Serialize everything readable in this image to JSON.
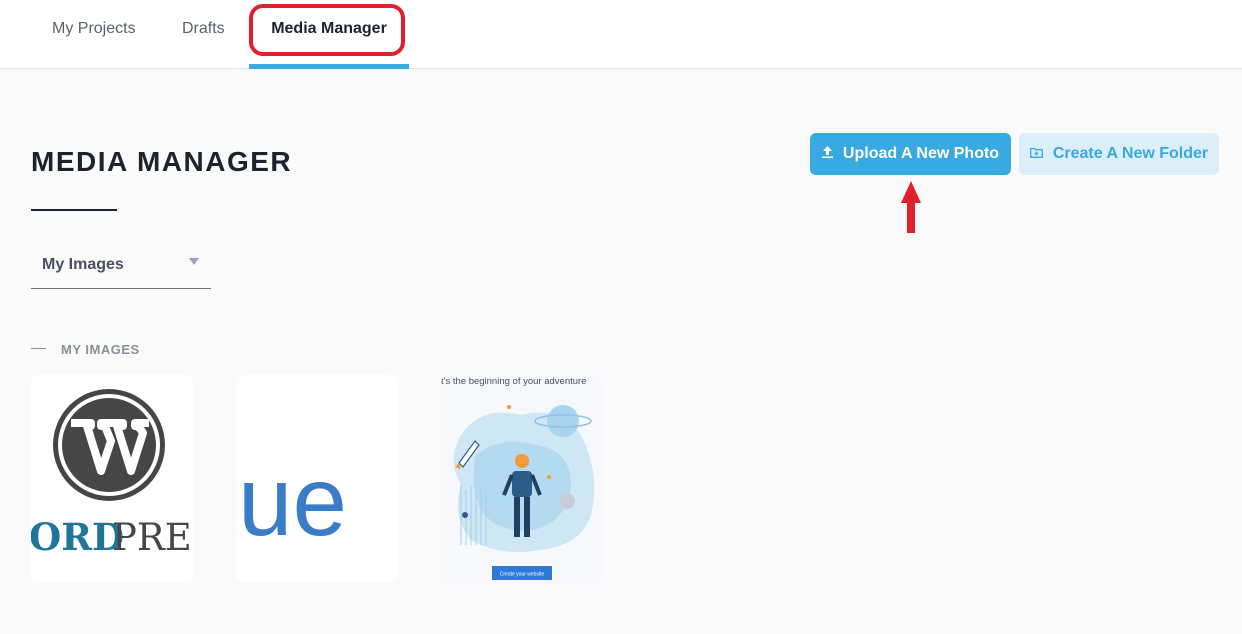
{
  "nav": {
    "tabs": [
      {
        "label": "My Projects"
      },
      {
        "label": "Drafts"
      },
      {
        "label": "Media Manager",
        "active": true
      }
    ]
  },
  "page": {
    "title": "MEDIA MANAGER"
  },
  "actions": {
    "upload_label": "Upload A New Photo",
    "folder_label": "Create A New Folder"
  },
  "filter": {
    "selected": "My Images"
  },
  "section": {
    "label": "MY IMAGES"
  },
  "images": [
    {
      "name": "wordpress-logo",
      "text": "ORDPRE"
    },
    {
      "name": "ue-logo",
      "text": "ue"
    },
    {
      "name": "adventure-illustration",
      "caption": "t's the beginning of your adventure",
      "cta": "Create your website"
    }
  ],
  "colors": {
    "accent": "#38a9e1",
    "accent_light": "#dceef8",
    "annotation": "#e0202c",
    "title": "#1d2230"
  }
}
